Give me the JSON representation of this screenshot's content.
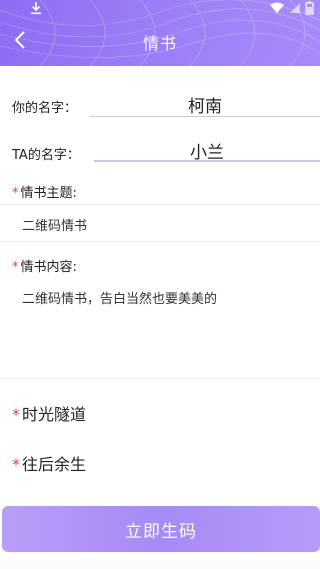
{
  "header": {
    "title": "情书",
    "accent": "#9a7df7"
  },
  "form": {
    "your_name_label": "你的名字：",
    "your_name_value": "柯南",
    "ta_name_label": "TA的名字：",
    "ta_name_value": "小兰",
    "required_mark": "*",
    "theme_label": "情书主题:",
    "theme_value": "二维码情书",
    "content_label": "情书内容:",
    "content_value": "二维码情书，告白当然也要美美的",
    "time_tunnel_label": "时光隧道",
    "future_label": "往后余生"
  },
  "actions": {
    "generate_label": "立即生码"
  },
  "icons": {
    "back": "chevron-left-icon",
    "download": "download-icon",
    "wifi": "wifi-icon",
    "signal": "signal-icon",
    "battery": "battery-icon"
  }
}
